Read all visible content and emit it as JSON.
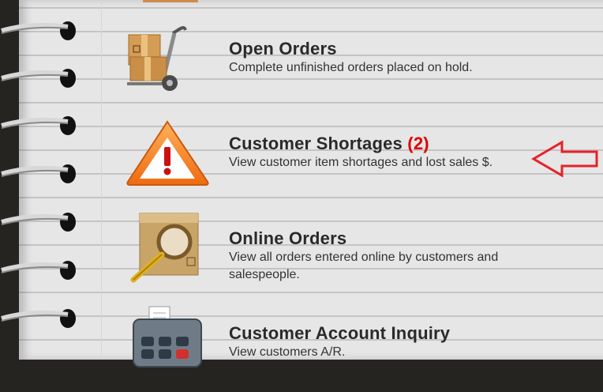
{
  "menu": {
    "items": [
      {
        "title": "Open Orders",
        "count": "",
        "description": "Complete unfinished orders placed on hold."
      },
      {
        "title": "Customer Shortages",
        "count": "(2)",
        "description": "View customer item shortages and lost sales $."
      },
      {
        "title": "Online Orders",
        "count": "",
        "description": "View all orders entered online by customers and salespeople."
      },
      {
        "title": "Customer Account Inquiry",
        "count": "",
        "description": "View customers A/R."
      }
    ]
  },
  "colors": {
    "paper": "#e6e6e6",
    "rule_line": "#c4c4c4",
    "alert_count": "#e00000",
    "annotation_arrow": "#e8202a"
  },
  "icons": [
    "hand-truck-icon",
    "warning-icon",
    "search-box-icon",
    "credit-card-terminal-icon"
  ]
}
